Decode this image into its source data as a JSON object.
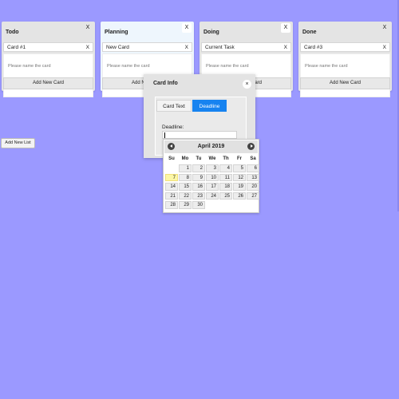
{
  "lists": [
    {
      "title": "Todo",
      "close": "X",
      "card": "Card #1",
      "card_close": "X",
      "placeholder": "Please name the card",
      "add_button": "Add New Card"
    },
    {
      "title": "Planning",
      "close": "X",
      "card": "New Card",
      "card_close": "X",
      "placeholder": "Please name the card",
      "add_button": "Add New Card"
    },
    {
      "title": "Doing",
      "close": "X",
      "card": "Current Task",
      "card_close": "X",
      "placeholder": "Please name the card",
      "add_button": "Add New Card"
    },
    {
      "title": "Done",
      "close": "X",
      "card": "Card #3",
      "card_close": "X",
      "placeholder": "Please name the card",
      "add_button": "Add New Card"
    }
  ],
  "add_list_button": "Add New List",
  "modal": {
    "title": "Card Info",
    "close": "×",
    "tabs": [
      "Card Text",
      "Deadline"
    ],
    "active_tab": "Deadline",
    "deadline_label": "Deadline:",
    "deadline_value": ""
  },
  "calendar": {
    "month_label": "April 2019",
    "weekdays": [
      "Su",
      "Mo",
      "Tu",
      "We",
      "Th",
      "Fr",
      "Sa"
    ],
    "first_weekday_index": 1,
    "days_in_month": 30,
    "highlighted_day": 7
  },
  "colors": {
    "background": "#9b99ff",
    "active_tab": "#1783f0",
    "today_highlight": "#fcf7a6"
  }
}
